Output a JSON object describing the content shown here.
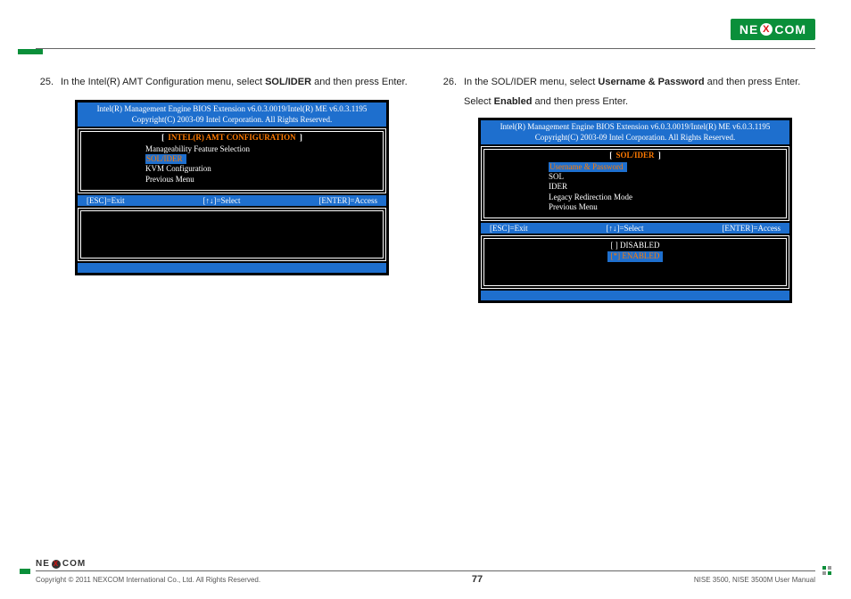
{
  "header": {
    "logo_left": "NE",
    "logo_right": "COM",
    "logo_x": "X"
  },
  "steps": {
    "left": {
      "num": "25.",
      "text_pre": "In the Intel(R) AMT Configuration menu, select ",
      "bold": "SOL/IDER",
      "text_post": " and then press Enter."
    },
    "right": {
      "num": "26.",
      "text_pre": "In the SOL/IDER menu, select ",
      "bold": "Username & Password",
      "text_post": " and then press Enter."
    },
    "right_sub_pre": "Select ",
    "right_sub_bold": "Enabled",
    "right_sub_post": " and then press Enter."
  },
  "bios_common": {
    "hdr1": "Intel(R) Management Engine BIOS Extension v6.0.3.0019/Intel(R) ME v6.0.3.1195",
    "hdr2": "Copyright(C) 2003-09 Intel Corporation. All Rights Reserved.",
    "key_esc": "[ESC]=Exit",
    "key_sel": "[↑↓]=Select",
    "key_enter": "[ENTER]=Access",
    "bracket_l": "[",
    "bracket_r": "]"
  },
  "bios_left": {
    "title": "INTEL(R) AMT CONFIGURATION",
    "items": [
      "Manageability Feature Selection",
      "SOL/IDER",
      "KVM Configuration",
      "Previous Menu"
    ],
    "selected_index": 1
  },
  "bios_right": {
    "title": "SOL/IDER",
    "items": [
      "Username & Password",
      "SOL",
      "IDER",
      "Legacy Redirection Mode",
      "Previous Menu"
    ],
    "selected_index": 0,
    "options": {
      "disabled": "[  ] DISABLED",
      "enabled": "[*] ENABLED"
    }
  },
  "footer": {
    "logo_left": "NE",
    "logo_right": "COM",
    "logo_x": "X",
    "copyright": "Copyright © 2011 NEXCOM International Co., Ltd. All Rights Reserved.",
    "page": "77",
    "doc": "NISE 3500, NISE 3500M User Manual"
  }
}
